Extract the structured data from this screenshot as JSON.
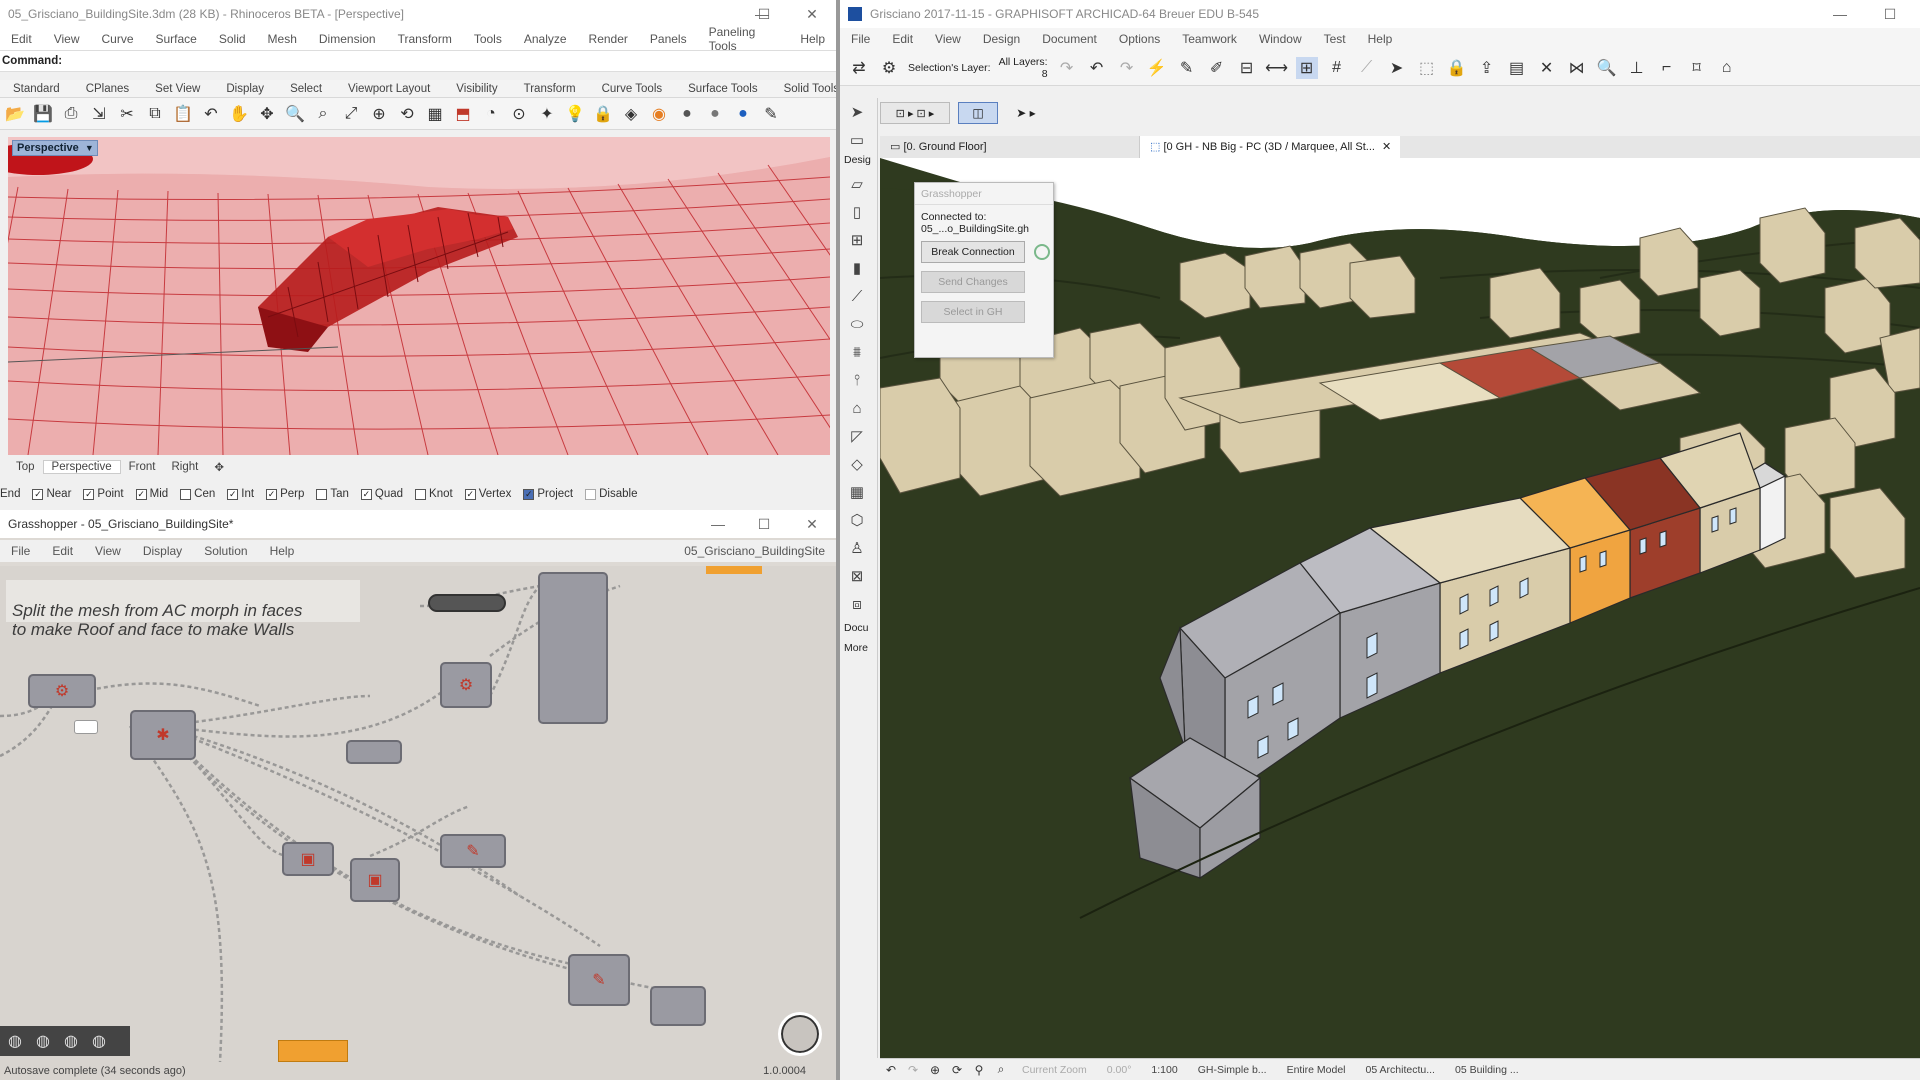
{
  "rhino": {
    "title": "05_Grisciano_BuildingSite.3dm (28 KB) - Rhinoceros BETA - [Perspective]",
    "menu": [
      "Edit",
      "View",
      "Curve",
      "Surface",
      "Solid",
      "Mesh",
      "Dimension",
      "Transform",
      "Tools",
      "Analyze",
      "Render",
      "Panels",
      "Paneling Tools",
      "Help"
    ],
    "command_label": "Command:",
    "toolbar_tabs": [
      "Standard",
      "CPlanes",
      "Set View",
      "Display",
      "Select",
      "Viewport Layout",
      "Visibility",
      "Transform",
      "Curve Tools",
      "Surface Tools",
      "Solid Tools"
    ],
    "viewport_label": "Perspective",
    "view_tabs": [
      "Top",
      "Perspective",
      "Front",
      "Right"
    ],
    "osnaps": [
      {
        "label": "End",
        "on": true
      },
      {
        "label": "Near",
        "on": true
      },
      {
        "label": "Point",
        "on": true
      },
      {
        "label": "Mid",
        "on": true
      },
      {
        "label": "Cen",
        "on": false
      },
      {
        "label": "Int",
        "on": true
      },
      {
        "label": "Perp",
        "on": true
      },
      {
        "label": "Tan",
        "on": false
      },
      {
        "label": "Quad",
        "on": true
      },
      {
        "label": "Knot",
        "on": false
      },
      {
        "label": "Vertex",
        "on": true
      },
      {
        "label": "Project",
        "on": true
      },
      {
        "label": "Disable",
        "on": false
      }
    ]
  },
  "grasshopper": {
    "title": "Grasshopper - 05_Grisciano_BuildingSite*",
    "menu": [
      "File",
      "Edit",
      "View",
      "Display",
      "Solution",
      "Help"
    ],
    "doc_name": "05_Grisciano_BuildingSite",
    "note": "Split the mesh from AC morph in faces\nto make Roof and face to make Walls",
    "status": "Autosave complete (34 seconds ago)",
    "version": "1.0.0004"
  },
  "archicad": {
    "title": "Grisciano 2017-11-15 - GRAPHISOFT ARCHICAD-64 Breuer EDU B-545",
    "menu": [
      "File",
      "Edit",
      "View",
      "Design",
      "Document",
      "Options",
      "Teamwork",
      "Window",
      "Test",
      "Help"
    ],
    "selection_layer_label": "Selection's Layer:",
    "all_layers_label": "All Layers:",
    "all_layers_value": "8",
    "tab_floor": "[0. Ground Floor]",
    "tab_3d": "[0 GH - NB Big - PC (3D / Marquee, All St...",
    "left_labels": {
      "design": "Desig",
      "docu": "Docu",
      "more": "More"
    },
    "gh_panel": {
      "title": "Grasshopper",
      "connected_label": "Connected to:",
      "connected_file": "05_...o_BuildingSite.gh",
      "break_button": "Break Connection",
      "send_button": "Send Changes",
      "select_button": "Select in GH"
    },
    "status_bar": [
      "Current Zoom",
      "0.00°",
      "1:100",
      "GH-Simple b...",
      "Entire Model",
      "05 Architectu...",
      "05 Building ..."
    ]
  },
  "colors": {
    "rhino_viewport": "#e8a3a3",
    "rhino_grid": "#c1272d",
    "archicad_ground": "#2f3a1f",
    "building_beige": "#d9ccaa",
    "building_gray": "#a3a3a8",
    "building_orange": "#f0a440",
    "building_brown": "#9e3e2b"
  }
}
